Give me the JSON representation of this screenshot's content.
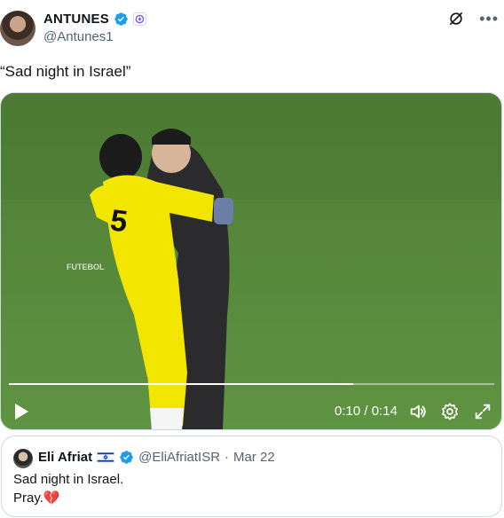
{
  "author": {
    "display_name": "ANTUNES",
    "handle": "@Antunes1"
  },
  "tweet": {
    "text": "“Sad night in Israel”"
  },
  "video": {
    "watermark_line1": "FUTEBOL",
    "current_time": "0:10",
    "separator": "/",
    "duration": "0:14",
    "time_display": "0:10 / 0:14",
    "progress_fraction": 0.71
  },
  "quote": {
    "display_name": "Eli Afriat",
    "handle": "@EliAfriatISR",
    "dot": "·",
    "date": "Mar 22",
    "line1": "Sad night in Israel.",
    "line2": "Pray.💔"
  },
  "icons": {
    "verified": "verified-badge-icon",
    "affiliation": "affiliation-badge-icon",
    "grok": "grok-icon",
    "more": "more-icon",
    "play": "play-icon",
    "volume": "volume-icon",
    "settings": "settings-gear-icon",
    "fullscreen": "fullscreen-icon",
    "flag": "israel-flag-icon"
  },
  "colors": {
    "verified_blue": "#1d9bf0",
    "pitch_green": "#5a8a3f",
    "jersey_yellow": "#f2e600",
    "text_secondary": "#536471"
  }
}
